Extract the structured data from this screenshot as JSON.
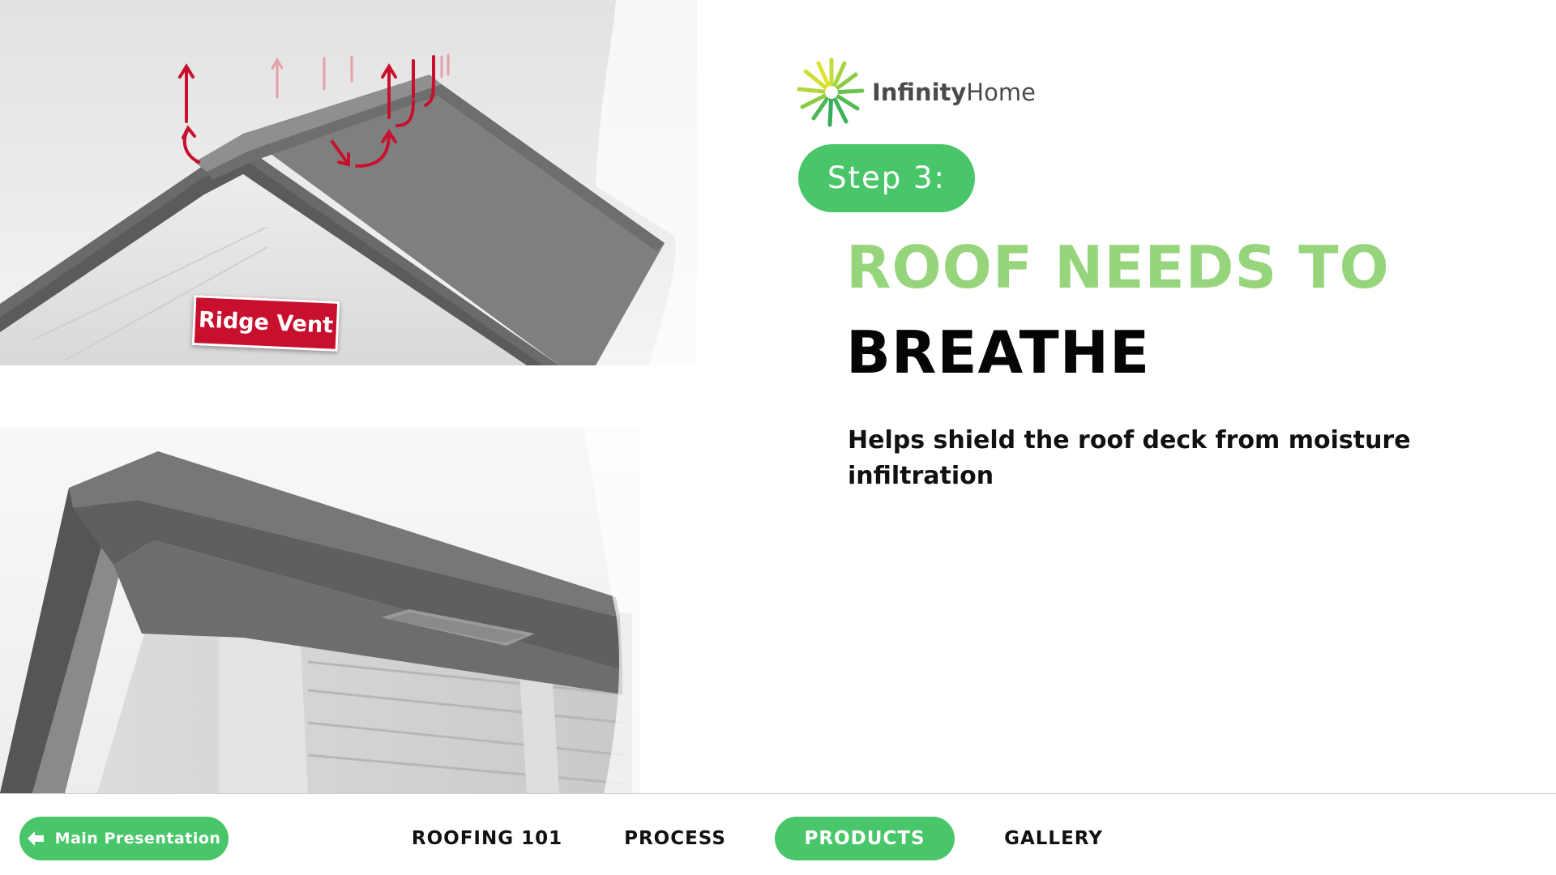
{
  "brand": {
    "name_bold": "Infinity",
    "name_light": "Home",
    "accent_color": "#4ac66a",
    "heading_green": "#96d57c",
    "sign_red": "#c8102e"
  },
  "images": {
    "ridge": {
      "label": "Ridge Vent"
    }
  },
  "content": {
    "step_label": "Step 3:",
    "heading_line1": "ROOF NEEDS TO",
    "heading_line2": "BREATHE",
    "body": "Helps shield the roof deck from moisture infiltration"
  },
  "nav": {
    "main_presentation": "Main Presentation",
    "items": [
      {
        "label": "ROOFING 101",
        "active": false
      },
      {
        "label": "PROCESS",
        "active": false
      },
      {
        "label": "PRODUCTS",
        "active": true
      },
      {
        "label": "GALLERY",
        "active": false
      }
    ]
  },
  "icons": {
    "back": "arrow-left-icon",
    "logo": "sunburst-logo-icon"
  }
}
